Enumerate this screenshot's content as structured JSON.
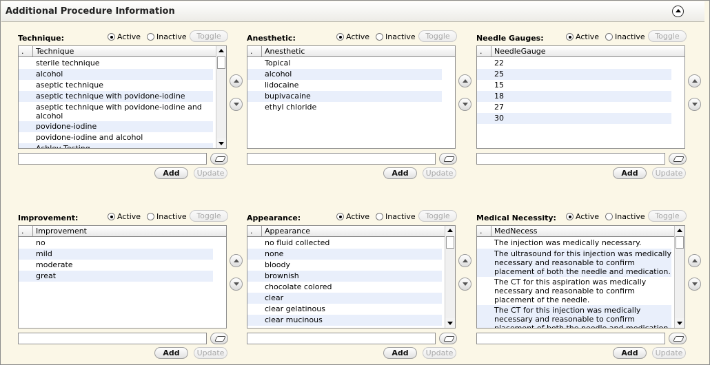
{
  "header": {
    "title": "Additional Procedure Information"
  },
  "labels": {
    "active": "Active",
    "inactive": "Inactive",
    "toggle": "Toggle",
    "add": "Add",
    "update": "Update",
    "dot_col": "."
  },
  "panels": [
    {
      "title": "Technique:",
      "column": "Technique",
      "selected": "active",
      "items": [
        "sterile technique",
        "alcohol",
        "aseptic technique",
        "aseptic technique with povidone-iodine",
        "aseptic technique with povidone-iodine and alcohol",
        "povidone-iodine",
        "povidone-iodine and alcohol",
        "Ashley Testing"
      ],
      "has_scrollbar": true,
      "input_value": ""
    },
    {
      "title": "Anesthetic:",
      "column": "Anesthetic",
      "selected": "active",
      "items": [
        "Topical",
        "alcohol",
        "lidocaine",
        "bupivacaine",
        "ethyl chloride"
      ],
      "has_scrollbar": false,
      "input_value": ""
    },
    {
      "title": "Needle Gauges:",
      "column": "NeedleGauge",
      "selected": "active",
      "items": [
        "22",
        "25",
        "15",
        "18",
        "27",
        "30"
      ],
      "has_scrollbar": false,
      "input_value": ""
    },
    {
      "title": "Improvement:",
      "column": "Improvement",
      "selected": "active",
      "items": [
        "no",
        "mild",
        "moderate",
        "great"
      ],
      "has_scrollbar": false,
      "input_value": ""
    },
    {
      "title": "Appearance:",
      "column": "Appearance",
      "selected": "active",
      "items": [
        "no fluid collected",
        "none",
        "bloody",
        "brownish",
        "chocolate colored",
        "clear",
        "clear gelatinous",
        "clear mucinous"
      ],
      "has_scrollbar": true,
      "input_value": ""
    },
    {
      "title": "Medical Necessity:",
      "column": "MedNecess",
      "selected": "active",
      "items": [
        "The injection was medically necessary.",
        "The ultrasound for this injection was medically necessary and reasonable to confirm placement of both the needle and medication.",
        "The CT for this aspiration was medically necessary and reasonable to confirm placement of the needle.",
        "The CT for this injection was medically necessary and reasonable to confirm placement of both the needle and medication."
      ],
      "has_scrollbar": true,
      "input_value": ""
    }
  ]
}
